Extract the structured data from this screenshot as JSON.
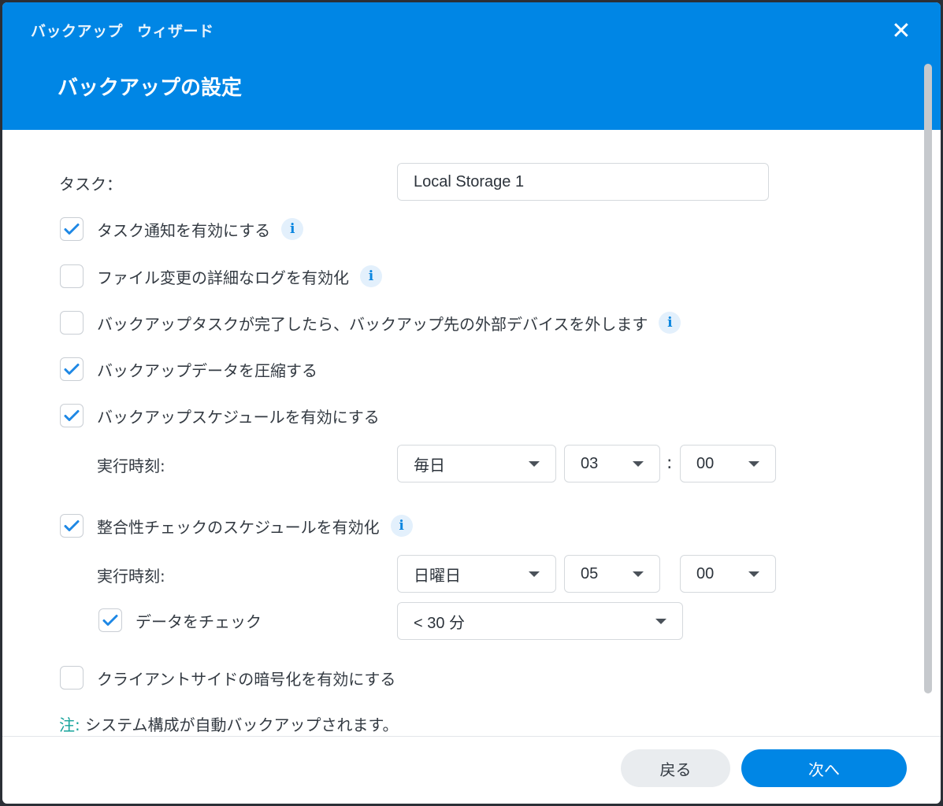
{
  "dialog": {
    "wizard_title_part1": "バックアップ",
    "wizard_title_part2": "ウィザード",
    "page_title": "バックアップの設定"
  },
  "colors": {
    "accent": "#0086e5",
    "note": "#16a39b"
  },
  "task": {
    "label": "タスク：",
    "value": "Local Storage 1"
  },
  "options": [
    {
      "label": "タスク通知を有効にする",
      "checked": true,
      "info": true
    },
    {
      "label": "ファイル変更の詳細なログを有効化",
      "checked": false,
      "info": true
    },
    {
      "label": "バックアップタスクが完了したら、バックアップ先の外部デバイスを外します",
      "checked": false,
      "info": true
    },
    {
      "label": "バックアップデータを圧縮する",
      "checked": true,
      "info": false
    },
    {
      "label": "バックアップスケジュールを有効にする",
      "checked": true,
      "info": false
    }
  ],
  "schedule": {
    "label": "実行時刻:",
    "frequency": "毎日",
    "hour": "03",
    "colon": ":",
    "minute": "00"
  },
  "integrity": {
    "label": "整合性チェックのスケジュールを有効化",
    "checked": true,
    "time_label": "実行時刻:",
    "day": "日曜日",
    "hour": "05",
    "minute": "00",
    "check_data_label": "データをチェック",
    "check_data_checked": true,
    "duration": "< 30 分"
  },
  "encryption": {
    "label": "クライアントサイドの暗号化を有効にする",
    "checked": false
  },
  "note": {
    "prefix": "注:",
    "text": " システム構成が自動バックアップされます。"
  },
  "buttons": {
    "back": "戻る",
    "next": "次へ"
  },
  "icons": {
    "close": "close-icon",
    "info": "info-icon",
    "check": "checkmark-icon",
    "caret": "chevron-down-icon"
  }
}
